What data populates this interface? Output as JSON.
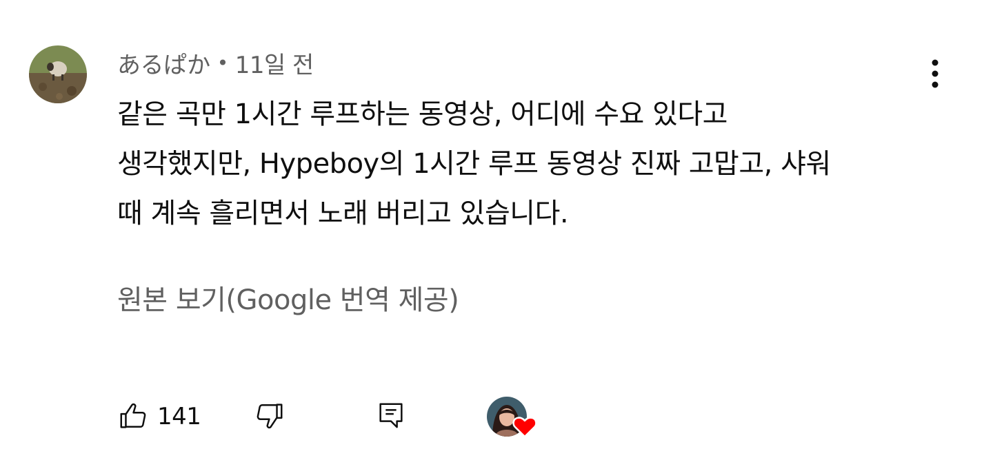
{
  "comment": {
    "author": "あるぱか",
    "separator": "•",
    "time": "11일 전",
    "lines": [
      "같은 곡만 1시간 루프하는 동영상, 어디에 수요 있다고",
      "생각했지만, Hypeboy의 1시간 루프 동영상 진짜 고맙고, 샤워",
      "때 계속 흘리면서 노래 버리고 있습니다."
    ],
    "translate_link": "원본 보기(Google 번역 제공)",
    "like_count": "141"
  },
  "icons": {
    "more": "more-vert-icon",
    "like": "thumb-up-icon",
    "dislike": "thumb-down-icon",
    "reply": "comment-icon",
    "heart": "heart-icon"
  },
  "colors": {
    "text_primary": "#0f0f0f",
    "text_secondary": "#606060",
    "heart": "#ff0000"
  }
}
